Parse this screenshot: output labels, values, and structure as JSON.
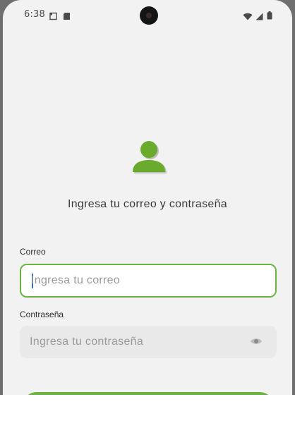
{
  "status_bar": {
    "time": "6:38"
  },
  "login": {
    "heading": "Ingresa tu correo y contraseña",
    "email_label": "Correo",
    "email_placeholder": "Ingresa tu correo",
    "email_value": "",
    "password_label": "Contraseña",
    "password_placeholder": "Ingresa tu contraseña",
    "password_value": "",
    "submit_label": ""
  },
  "icons": {
    "avatar": "user-avatar-icon",
    "password_toggle": "eye-icon"
  },
  "colors": {
    "accent": "#6db33f",
    "avatar": "#6aab2e",
    "avatar_shadow": "#bdbdbd",
    "background": "#f2f2f2",
    "frame": "#6f6f6f"
  }
}
